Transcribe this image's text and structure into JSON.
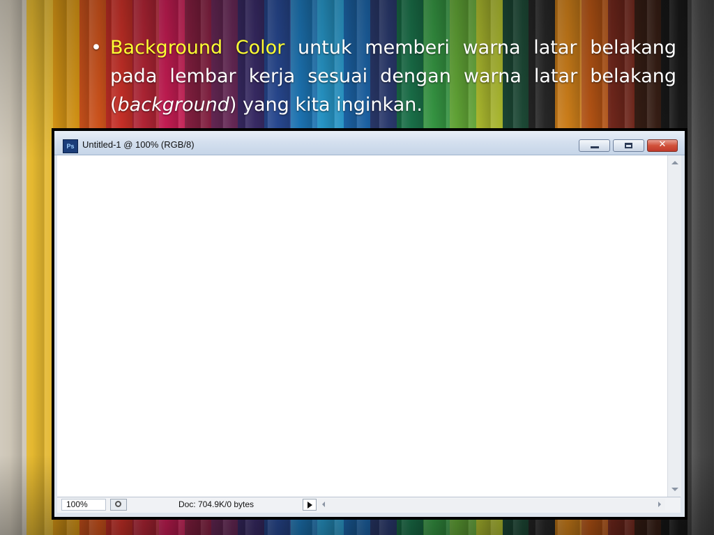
{
  "slide": {
    "bullet": "•",
    "line1_highlight": "Background Color",
    "line1_rest": " untuk memberi warna latar belakang",
    "line2": "pada lembar kerja sesuai dengan warna latar belakang",
    "line3_open": "(",
    "line3_italic": "background",
    "line3_rest": ") yang kita inginkan.",
    "highlight_color": "#ffff33"
  },
  "window": {
    "app_icon_label": "Ps",
    "title": "Untitled-1 @ 100% (RGB/8)",
    "close_glyph": "✕"
  },
  "status": {
    "zoom": "100%",
    "doc_info": "Doc: 704.9K/0 bytes"
  },
  "background_colors": [
    "#d8d0c0",
    "#f1c232",
    "#e6a017",
    "#e05a1e",
    "#d9342b",
    "#c2283a",
    "#d61f5a",
    "#8e2145",
    "#6f2b5d",
    "#3d2e6e",
    "#2b4f9e",
    "#1f7fc4",
    "#2aa3d9",
    "#1e6bb3",
    "#2e3f78",
    "#1c7a4f",
    "#3aa348",
    "#6ab43b",
    "#b9c832",
    "#1f4f3a",
    "#2a2a2a",
    "#e08a1c",
    "#c45b16",
    "#7a2a1e",
    "#3b2016",
    "#1a1a1a",
    "#4a4a4a"
  ]
}
